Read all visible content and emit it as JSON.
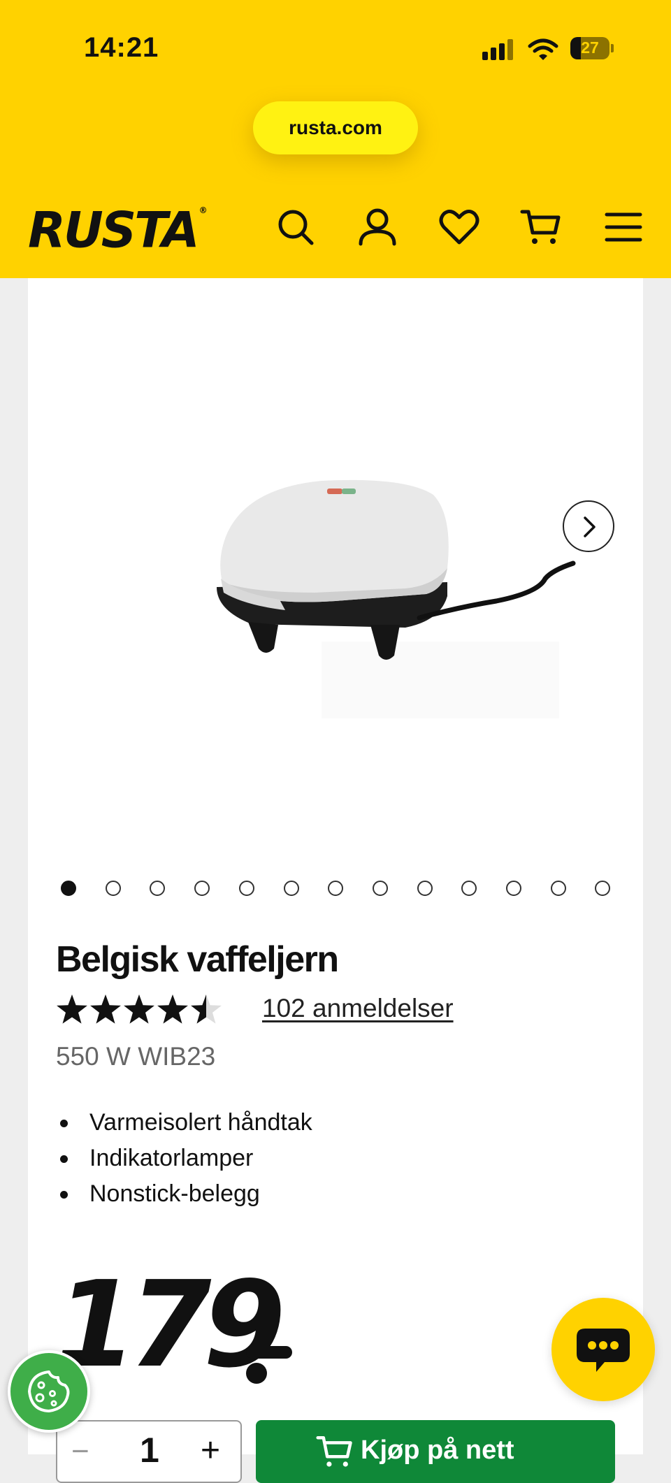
{
  "status_bar": {
    "time": "14:21",
    "battery": "27",
    "battery_level": 0.27
  },
  "browser": {
    "url": "rusta.com"
  },
  "header": {
    "logo_text": "RUSTA",
    "logo_mark": "®",
    "icons": [
      "search-icon",
      "account-icon",
      "favorites-icon",
      "cart-icon",
      "menu-icon"
    ]
  },
  "gallery": {
    "image_count": 13,
    "active_index": 0,
    "next_icon": "chevron-right-icon"
  },
  "product": {
    "title": "Belgisk vaffeljern",
    "rating": 4.5,
    "rating_max": 5,
    "reviews_label": "102 anmeldelser",
    "model": "550 W WIB23",
    "features": [
      "Varmeisolert håndtak",
      "Indikatorlamper",
      "Nonstick-belegg"
    ],
    "price": "179"
  },
  "purchase": {
    "quantity": "1",
    "minus": "−",
    "plus": "+",
    "buy_label": "Kjøp på nett"
  },
  "colors": {
    "brand_yellow": "#ffd200",
    "url_pill_yellow": "#fff212",
    "buy_green": "#0f8838",
    "cookie_green": "#3fae49"
  }
}
